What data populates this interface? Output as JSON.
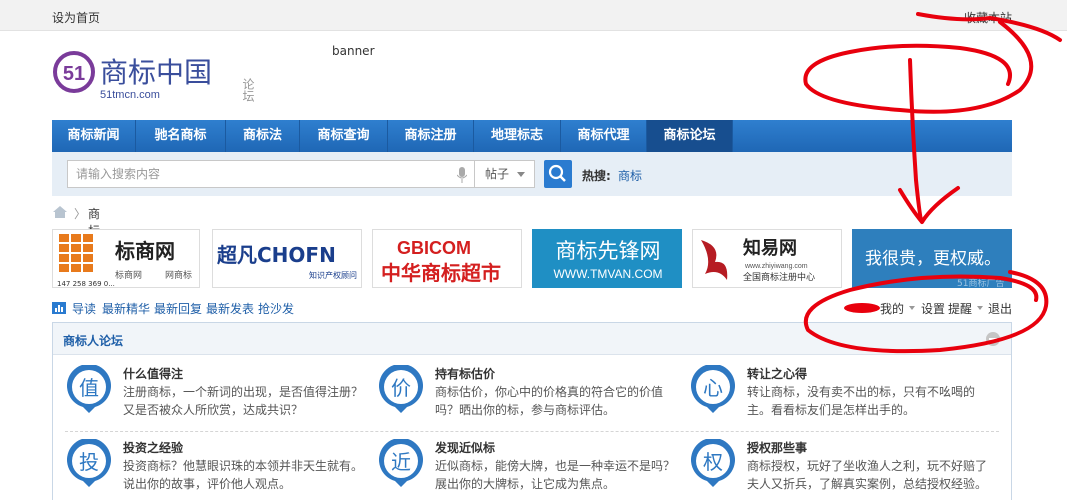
{
  "topbar": {
    "set_homepage": "设为首页",
    "bookmark": "收藏本站"
  },
  "logo": {
    "brand": "商标中国",
    "domain": "51tmcn.com",
    "badge": "51",
    "side": "论坛"
  },
  "banner_label": "banner",
  "nav": {
    "items": [
      {
        "label": "商标新闻"
      },
      {
        "label": "驰名商标"
      },
      {
        "label": "商标法"
      },
      {
        "label": "商标查询"
      },
      {
        "label": "商标注册"
      },
      {
        "label": "地理标志"
      },
      {
        "label": "商标代理"
      },
      {
        "label": "商标论坛",
        "active": true
      }
    ]
  },
  "search": {
    "placeholder": "请输入搜索内容",
    "scope": "帖子",
    "hot_label": "热搜:",
    "hot_link": "商标"
  },
  "breadcrumb": {
    "sep": "〉",
    "current": "商标论坛"
  },
  "ads": [
    {
      "title": "标商网",
      "sub1": "标商网",
      "sub2": "网商标",
      "phone": "147 258 369 0..."
    },
    {
      "title": "超凡CHOFN",
      "sub": "知识产权顾问"
    },
    {
      "title": "GBICOM",
      "sub": "中华商标超市"
    },
    {
      "title": "商标先锋网",
      "sub": "WWW.TMVAN.COM"
    },
    {
      "title": "知易网",
      "url": "www.zhiyiwang.com",
      "sub": "全国商标注册中心"
    },
    {
      "title": "我很贵，更权威。",
      "sub": "51商标广告"
    }
  ],
  "quicklinks": [
    "导读",
    "最新精华",
    "最新回复",
    "最新发表",
    "抢沙发"
  ],
  "userbar": {
    "mine": "我的",
    "settings": "设置",
    "remind": "提醒",
    "logout": "退出"
  },
  "forum": {
    "title": "商标人论坛",
    "subforums": [
      {
        "icon_char": "值",
        "name": "什么值得注",
        "desc": "注册商标，一个新词的出现，是否值得注册？又是否被众人所欣赏，达成共识？"
      },
      {
        "icon_char": "价",
        "name": "持有标估价",
        "desc": "商标估价，你心中的价格真的符合它的价值吗？晒出你的标，参与商标评估。"
      },
      {
        "icon_char": "心",
        "name": "转让之心得",
        "desc": "转让商标，没有卖不出的标，只有不吆喝的主。看看标友们是怎样出手的。"
      },
      {
        "icon_char": "投",
        "name": "投资之经验",
        "desc": "投资商标？他慧眼识珠的本领并非天生就有。说出你的故事，评价他人观点。"
      },
      {
        "icon_char": "近",
        "name": "发现近似标",
        "desc": "近似商标，能傍大牌，也是一种幸运不是吗？展出你的大牌标，让它成为焦点。"
      },
      {
        "icon_char": "权",
        "name": "授权那些事",
        "desc": "商标授权，玩好了坐收渔人之利，玩不好赔了夫人又折兵，了解真实案例，总结授权经验。"
      }
    ]
  },
  "colors": {
    "nav": "#1f67b5",
    "link": "#1f5fa8",
    "annotation": "#e8000d"
  }
}
